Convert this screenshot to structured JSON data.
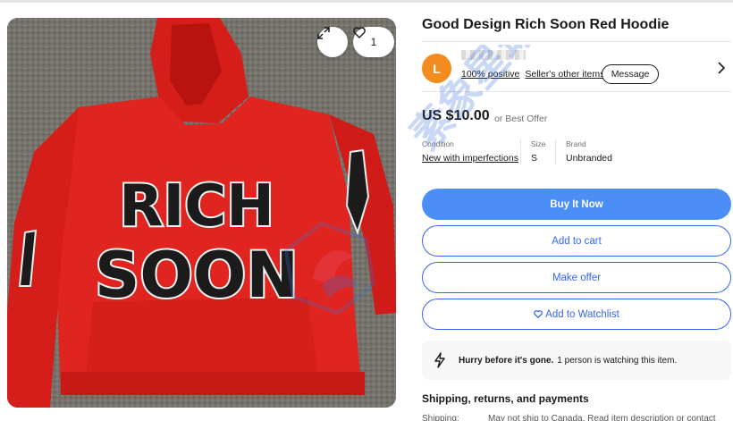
{
  "listing": {
    "title": "Good Design Rich Soon Red Hoodie",
    "watch_count": "1",
    "image_alt_text": "RICH SOON"
  },
  "seller": {
    "avatar_letter": "L",
    "feedback": "100% positive",
    "other_items": "Seller's other items",
    "message_label": "Message"
  },
  "price": {
    "amount": "US $10.00",
    "suffix": "or Best Offer"
  },
  "specs": {
    "condition_label": "Condition",
    "condition_value": "New with imperfections",
    "size_label": "Size",
    "size_value": "S",
    "brand_label": "Brand",
    "brand_value": "Unbranded"
  },
  "actions": {
    "buy_now": "Buy It Now",
    "add_to_cart": "Add to cart",
    "make_offer": "Make offer",
    "watchlist": "Add to Watchlist"
  },
  "urgency": {
    "headline": "Hurry before it's gone.",
    "detail": "1 person is watching this item."
  },
  "shipping": {
    "heading": "Shipping, returns, and payments",
    "row_label": "Shipping:",
    "row_value": "May not ship to Canada. Read item description or contact"
  },
  "watermark_text": "素象星球",
  "icons": [
    "expand-icon",
    "heart-icon",
    "chevron-right-icon",
    "heart-icon",
    "lightning-icon"
  ],
  "colors": {
    "primary_blue": "#3665f3",
    "buy_button": "#4b8ef5",
    "avatar": "#f28c1e",
    "hoodie": "#e0241f"
  }
}
